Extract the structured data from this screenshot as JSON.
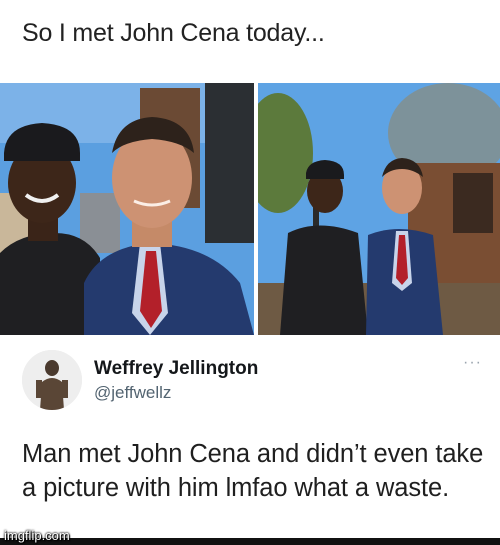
{
  "post": {
    "caption": "So I met John Cena today..."
  },
  "tweet": {
    "display_name": "Weffrey Jellington",
    "handle": "@jeffwellz",
    "more_glyph": "···",
    "text": "Man met John Cena and didn’t even take a picture with him lmfao what a waste."
  },
  "watermark": "imgflip.com",
  "icons": {
    "more": "more-options-icon",
    "avatar": "avatar-image"
  },
  "colors": {
    "sky_blue": "#5b9fe0",
    "suit_navy": "#243a6e",
    "chef_black": "#1f1f22",
    "tie_red": "#b3202a",
    "handle_gray": "#536471"
  }
}
